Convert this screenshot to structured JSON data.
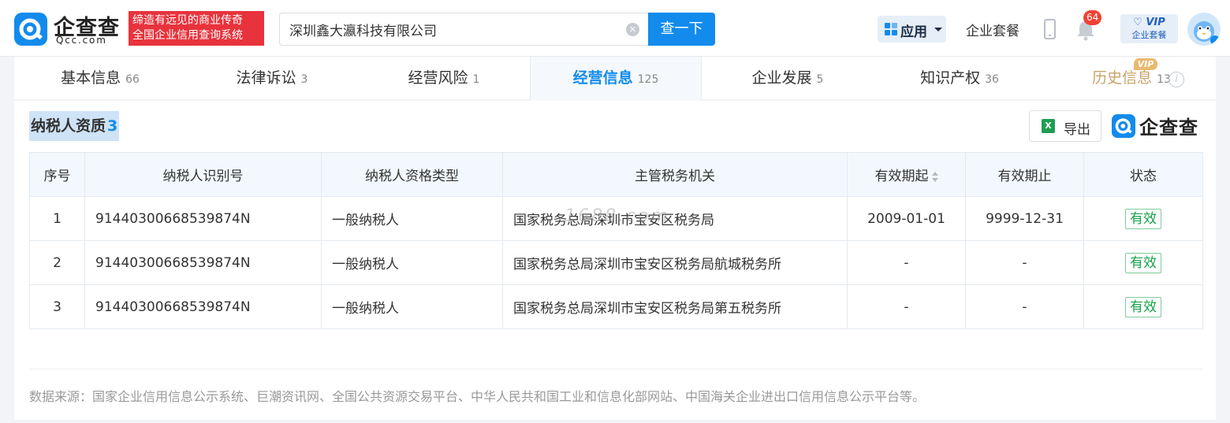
{
  "header": {
    "logo": {
      "name_cn": "企查查",
      "name_en": "Qcc.com"
    },
    "slogan": {
      "line1": "缔造有远见的商业传奇",
      "line2": "全国企业信用查询系统"
    },
    "search": {
      "value": "深圳鑫大瀛科技有限公司",
      "button_label": "查一下"
    },
    "app_menu_label": "应用",
    "package_link": "企业套餐",
    "notification_count": "64",
    "vip": {
      "top": "VIP",
      "bottom": "企业套餐"
    }
  },
  "tabs": [
    {
      "label": "基本信息",
      "count": "66"
    },
    {
      "label": "法律诉讼",
      "count": "3"
    },
    {
      "label": "经营风险",
      "count": "1"
    },
    {
      "label": "经营信息",
      "count": "125",
      "active": true
    },
    {
      "label": "企业发展",
      "count": "5"
    },
    {
      "label": "知识产权",
      "count": "36"
    },
    {
      "label": "历史信息",
      "count": "13",
      "vip_tag": "VIP"
    }
  ],
  "section": {
    "title": "纳税人资质",
    "count": "3",
    "export_label": "导出",
    "brand": "企查查"
  },
  "table": {
    "columns": [
      "序号",
      "纳税人识别号",
      "纳税人资格类型",
      "主管税务机关",
      "有效期起",
      "有效期止",
      "状态"
    ],
    "rows": [
      {
        "no": "1",
        "tax_id": "91440300668539874N",
        "type": "一般纳税人",
        "authority": "国家税务总局深圳市宝安区税务局",
        "start": "2009-01-01",
        "end": "9999-12-31",
        "status": "有效"
      },
      {
        "no": "2",
        "tax_id": "91440300668539874N",
        "type": "一般纳税人",
        "authority": "国家税务总局深圳市宝安区税务局航城税务所",
        "start": "-",
        "end": "-",
        "status": "有效"
      },
      {
        "no": "3",
        "tax_id": "91440300668539874N",
        "type": "一般纳税人",
        "authority": "国家税务总局深圳市宝安区税务局第五税务所",
        "start": "-",
        "end": "-",
        "status": "有效"
      }
    ]
  },
  "watermark": "1688.com",
  "source_note": "数据来源：国家企业信用信息公示系统、巨潮资讯网、全国公共资源交易平台、中华人民共和国工业和信息化部网站、中国海关企业进出口信用信息公示平台等。",
  "colors": {
    "brand_blue": "#128bed",
    "slogan_red": "#e8333c",
    "valid_green": "#16a34a",
    "vip_gold": "#c9a26a"
  }
}
